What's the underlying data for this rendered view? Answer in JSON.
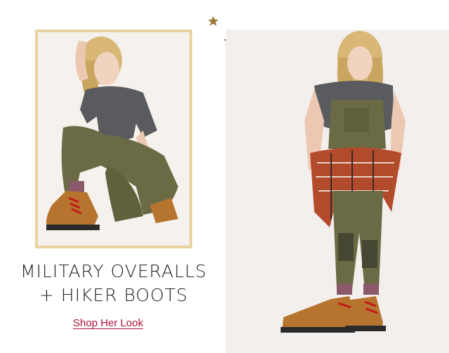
{
  "headline": {
    "line1": "MILITARY OVERALLS",
    "line2": "+ HIKER BOOTS"
  },
  "cta": {
    "shop_label": "Shop Her Look"
  },
  "colors": {
    "frame_gold": "#e9d3a2",
    "link_red": "#b0113a",
    "pants_olive": "#6a6b45",
    "boot_tan": "#b6742e",
    "lace_red": "#c21a1a",
    "star_gold": "#9c7a3a"
  },
  "decor": {
    "icons": [
      "star-icon"
    ]
  }
}
